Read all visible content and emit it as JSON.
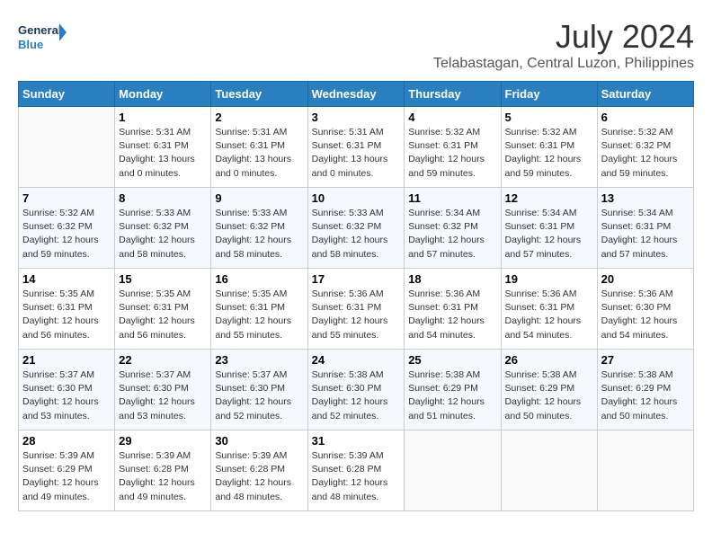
{
  "header": {
    "logo_text_general": "General",
    "logo_text_blue": "Blue",
    "month_year": "July 2024",
    "location": "Telabastagan, Central Luzon, Philippines"
  },
  "days_of_week": [
    "Sunday",
    "Monday",
    "Tuesday",
    "Wednesday",
    "Thursday",
    "Friday",
    "Saturday"
  ],
  "weeks": [
    [
      {
        "day": "",
        "info": ""
      },
      {
        "day": "1",
        "info": "Sunrise: 5:31 AM\nSunset: 6:31 PM\nDaylight: 13 hours\nand 0 minutes."
      },
      {
        "day": "2",
        "info": "Sunrise: 5:31 AM\nSunset: 6:31 PM\nDaylight: 13 hours\nand 0 minutes."
      },
      {
        "day": "3",
        "info": "Sunrise: 5:31 AM\nSunset: 6:31 PM\nDaylight: 13 hours\nand 0 minutes."
      },
      {
        "day": "4",
        "info": "Sunrise: 5:32 AM\nSunset: 6:31 PM\nDaylight: 12 hours\nand 59 minutes."
      },
      {
        "day": "5",
        "info": "Sunrise: 5:32 AM\nSunset: 6:31 PM\nDaylight: 12 hours\nand 59 minutes."
      },
      {
        "day": "6",
        "info": "Sunrise: 5:32 AM\nSunset: 6:32 PM\nDaylight: 12 hours\nand 59 minutes."
      }
    ],
    [
      {
        "day": "7",
        "info": "Sunrise: 5:32 AM\nSunset: 6:32 PM\nDaylight: 12 hours\nand 59 minutes."
      },
      {
        "day": "8",
        "info": "Sunrise: 5:33 AM\nSunset: 6:32 PM\nDaylight: 12 hours\nand 58 minutes."
      },
      {
        "day": "9",
        "info": "Sunrise: 5:33 AM\nSunset: 6:32 PM\nDaylight: 12 hours\nand 58 minutes."
      },
      {
        "day": "10",
        "info": "Sunrise: 5:33 AM\nSunset: 6:32 PM\nDaylight: 12 hours\nand 58 minutes."
      },
      {
        "day": "11",
        "info": "Sunrise: 5:34 AM\nSunset: 6:32 PM\nDaylight: 12 hours\nand 57 minutes."
      },
      {
        "day": "12",
        "info": "Sunrise: 5:34 AM\nSunset: 6:31 PM\nDaylight: 12 hours\nand 57 minutes."
      },
      {
        "day": "13",
        "info": "Sunrise: 5:34 AM\nSunset: 6:31 PM\nDaylight: 12 hours\nand 57 minutes."
      }
    ],
    [
      {
        "day": "14",
        "info": "Sunrise: 5:35 AM\nSunset: 6:31 PM\nDaylight: 12 hours\nand 56 minutes."
      },
      {
        "day": "15",
        "info": "Sunrise: 5:35 AM\nSunset: 6:31 PM\nDaylight: 12 hours\nand 56 minutes."
      },
      {
        "day": "16",
        "info": "Sunrise: 5:35 AM\nSunset: 6:31 PM\nDaylight: 12 hours\nand 55 minutes."
      },
      {
        "day": "17",
        "info": "Sunrise: 5:36 AM\nSunset: 6:31 PM\nDaylight: 12 hours\nand 55 minutes."
      },
      {
        "day": "18",
        "info": "Sunrise: 5:36 AM\nSunset: 6:31 PM\nDaylight: 12 hours\nand 54 minutes."
      },
      {
        "day": "19",
        "info": "Sunrise: 5:36 AM\nSunset: 6:31 PM\nDaylight: 12 hours\nand 54 minutes."
      },
      {
        "day": "20",
        "info": "Sunrise: 5:36 AM\nSunset: 6:30 PM\nDaylight: 12 hours\nand 54 minutes."
      }
    ],
    [
      {
        "day": "21",
        "info": "Sunrise: 5:37 AM\nSunset: 6:30 PM\nDaylight: 12 hours\nand 53 minutes."
      },
      {
        "day": "22",
        "info": "Sunrise: 5:37 AM\nSunset: 6:30 PM\nDaylight: 12 hours\nand 53 minutes."
      },
      {
        "day": "23",
        "info": "Sunrise: 5:37 AM\nSunset: 6:30 PM\nDaylight: 12 hours\nand 52 minutes."
      },
      {
        "day": "24",
        "info": "Sunrise: 5:38 AM\nSunset: 6:30 PM\nDaylight: 12 hours\nand 52 minutes."
      },
      {
        "day": "25",
        "info": "Sunrise: 5:38 AM\nSunset: 6:29 PM\nDaylight: 12 hours\nand 51 minutes."
      },
      {
        "day": "26",
        "info": "Sunrise: 5:38 AM\nSunset: 6:29 PM\nDaylight: 12 hours\nand 50 minutes."
      },
      {
        "day": "27",
        "info": "Sunrise: 5:38 AM\nSunset: 6:29 PM\nDaylight: 12 hours\nand 50 minutes."
      }
    ],
    [
      {
        "day": "28",
        "info": "Sunrise: 5:39 AM\nSunset: 6:29 PM\nDaylight: 12 hours\nand 49 minutes."
      },
      {
        "day": "29",
        "info": "Sunrise: 5:39 AM\nSunset: 6:28 PM\nDaylight: 12 hours\nand 49 minutes."
      },
      {
        "day": "30",
        "info": "Sunrise: 5:39 AM\nSunset: 6:28 PM\nDaylight: 12 hours\nand 48 minutes."
      },
      {
        "day": "31",
        "info": "Sunrise: 5:39 AM\nSunset: 6:28 PM\nDaylight: 12 hours\nand 48 minutes."
      },
      {
        "day": "",
        "info": ""
      },
      {
        "day": "",
        "info": ""
      },
      {
        "day": "",
        "info": ""
      }
    ]
  ]
}
